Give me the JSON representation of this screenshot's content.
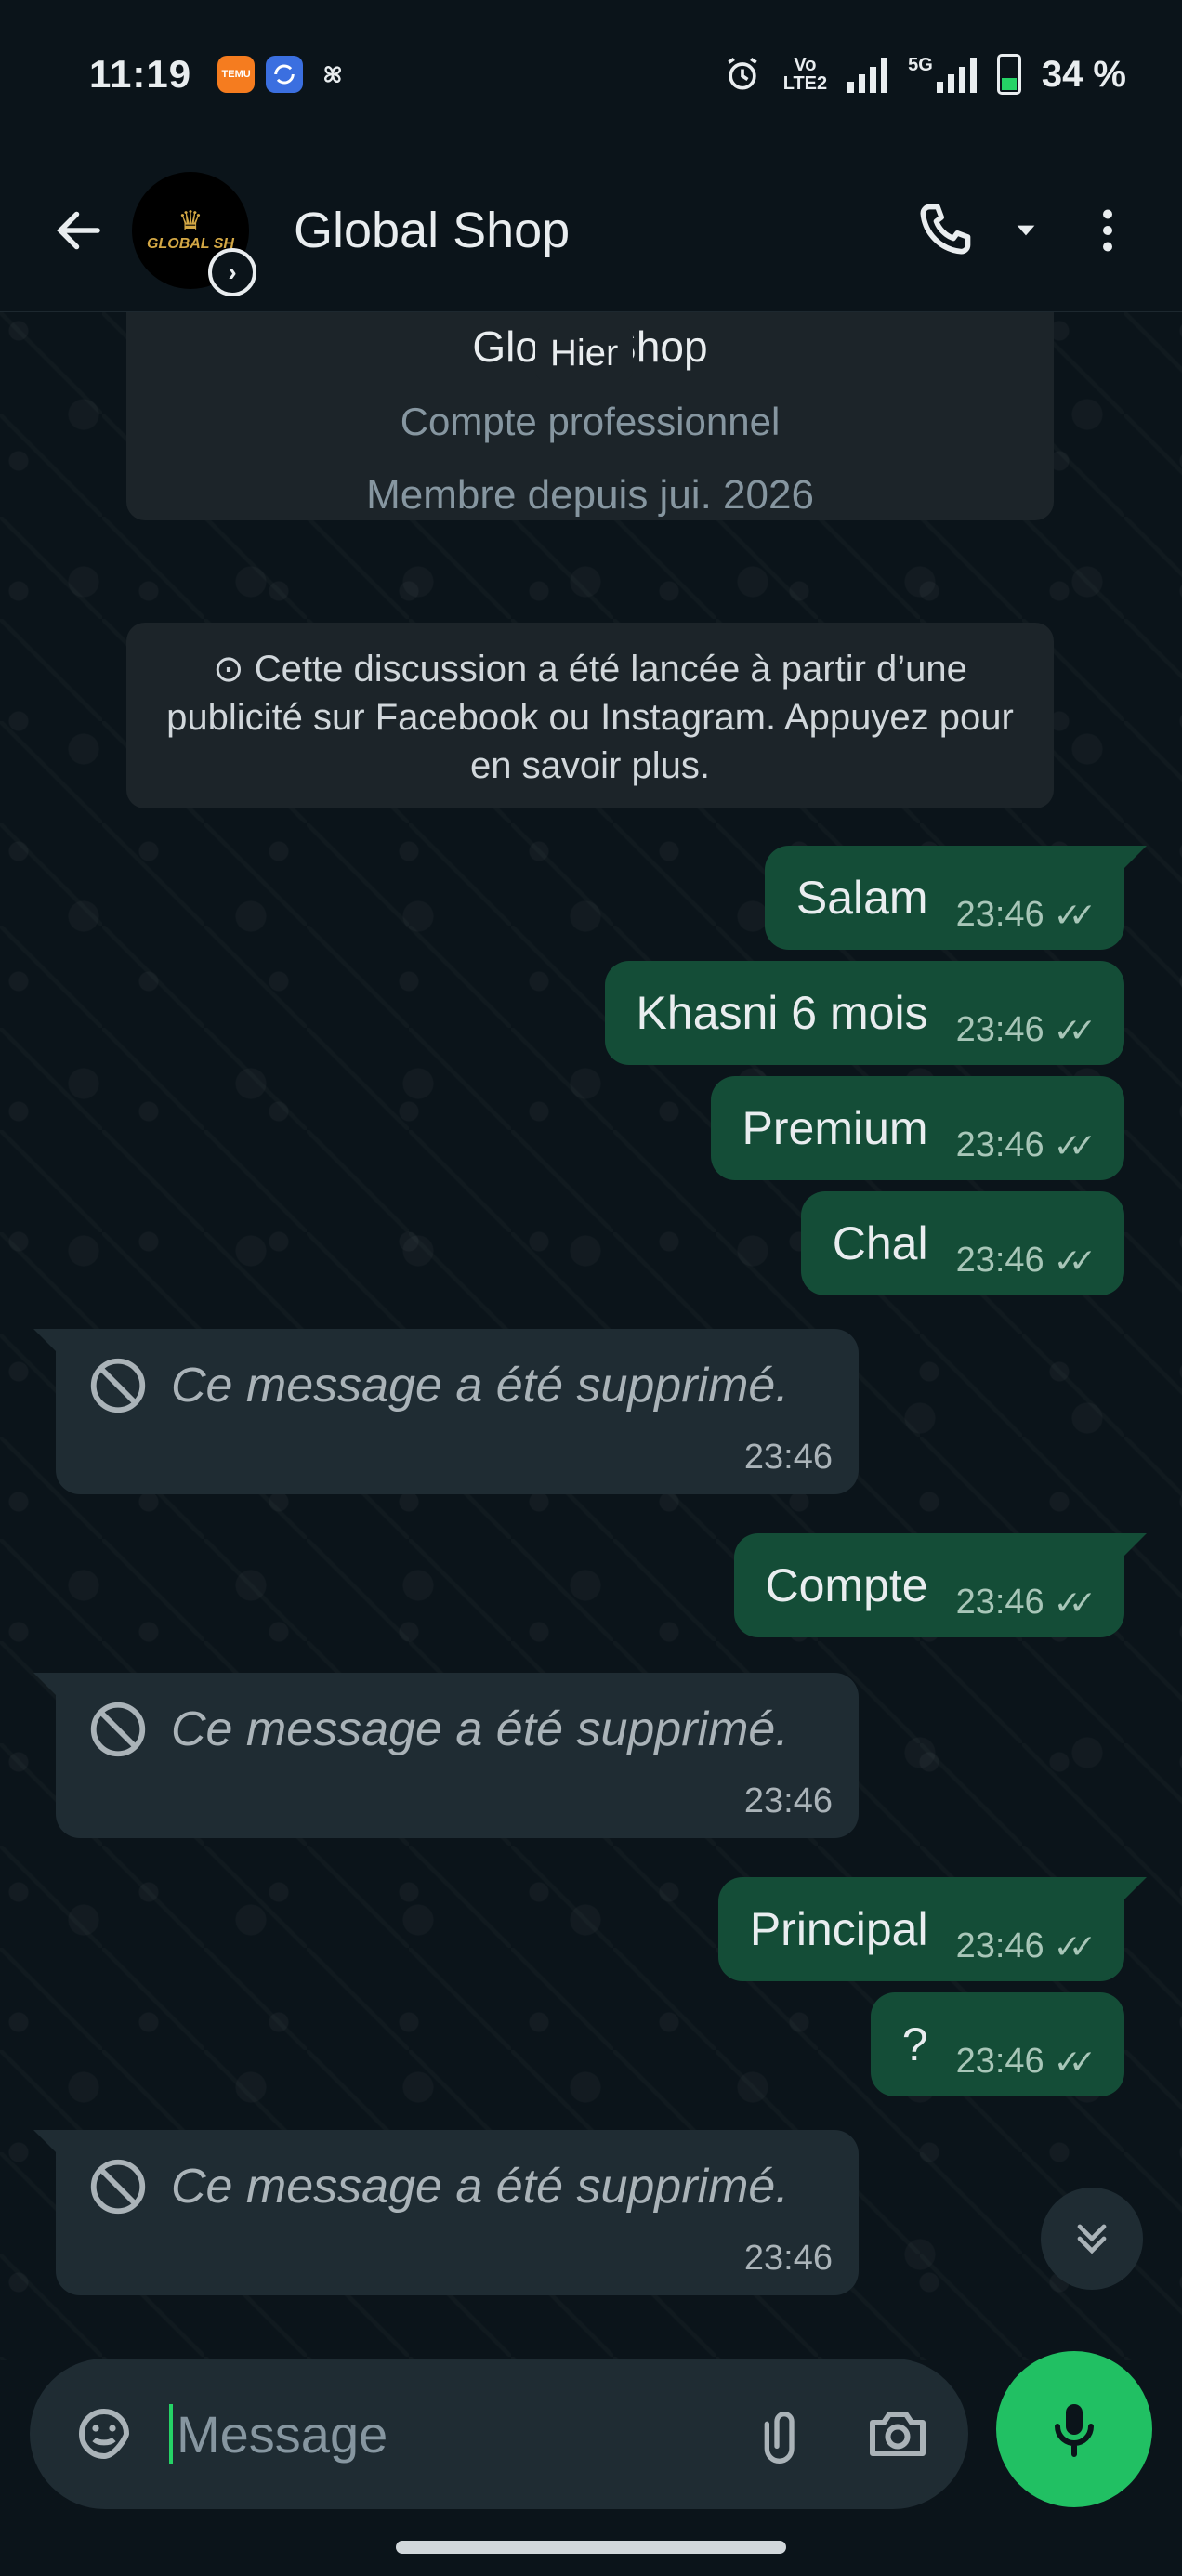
{
  "status_bar": {
    "time": "11:19",
    "app_temu_label": "TEMU",
    "volte_line1": "Vo",
    "volte_line2": "LTE2",
    "network": "5G",
    "battery": "34 %"
  },
  "header": {
    "contact_name": "Global Shop",
    "avatar_text": "GLOBAL SH"
  },
  "profile_card": {
    "name": "Global Shop",
    "type": "Compte professionnel",
    "member_since": "Membre depuis jui. 2026"
  },
  "date_chip": "Hier",
  "ad_notice": "Cette discussion a été lancée à partir d’une publicité sur Facebook ou Instagram. Appuyez pour en savoir plus.",
  "messages": [
    {
      "direction": "out",
      "text": "Salam",
      "time": "23:46"
    },
    {
      "direction": "out",
      "text": "Khasni 6 mois",
      "time": "23:46"
    },
    {
      "direction": "out",
      "text": "Premium",
      "time": "23:46"
    },
    {
      "direction": "out",
      "text": "Chal",
      "time": "23:46"
    },
    {
      "direction": "in",
      "text": "Ce message a été supprimé.",
      "time": "23:46"
    },
    {
      "direction": "out",
      "text": "Compte",
      "time": "23:46"
    },
    {
      "direction": "in",
      "text": "Ce message a été supprimé.",
      "time": "23:46"
    },
    {
      "direction": "out",
      "text": "Principal",
      "time": "23:46"
    },
    {
      "direction": "out",
      "text": "?",
      "time": "23:46"
    },
    {
      "direction": "in",
      "text": "Ce message a été supprimé.",
      "time": "23:46"
    }
  ],
  "composer": {
    "placeholder": "Message"
  },
  "colors": {
    "background": "#0b141a",
    "outgoing_bubble": "#144d37",
    "incoming_bubble": "#1f2c33",
    "accent": "#21c063"
  }
}
